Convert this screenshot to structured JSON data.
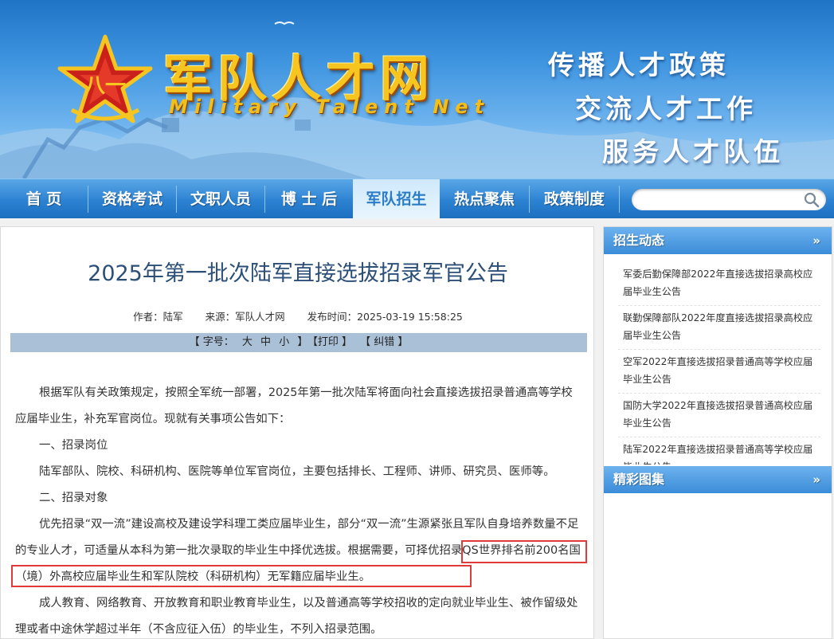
{
  "banner": {
    "title": "军队人才网",
    "title_en": "Military Talent Net",
    "slogans": [
      "传播人才政策",
      "交流人才工作",
      "服务人才队伍"
    ]
  },
  "nav": {
    "items": [
      "首 页",
      "资格考试",
      "文职人员",
      "博 士 后",
      "军队招生",
      "热点聚焦",
      "政策制度"
    ],
    "active": "军队招生",
    "search_placeholder": ""
  },
  "article": {
    "title": "2025年第一批次陆军直接选拔招录军官公告",
    "meta": {
      "author": "作者：陆军",
      "source": "来源：军队人才网",
      "published": "发布时间：2025-03-19 15:58:25"
    },
    "toolbar": {
      "font_label": "【 字号：",
      "size_large": "大",
      "size_medium": "中",
      "size_small": "小",
      "close1": "】",
      "print": "【打印 】",
      "correction": "【 纠错 】"
    },
    "paragraphs": {
      "intro": "根据军队有关政策规定，按照全军统一部署，2025年第一批次陆军将面向社会直接选拔招录普通高等学校应届毕业生，补充军官岗位。现就有关事项公告如下：",
      "h1": "一、招录岗位",
      "p1": "陆军部队、院校、科研机构、医院等单位军官岗位，主要包括排长、工程师、讲师、研究员、医师等。",
      "h2": "二、招录对象",
      "p2": "优先招录“双一流”建设高校及建设学科理工类应届毕业生，部分“双一流”生源紧张且军队自身培养数量不足的专业人才，可适量从本科为第一批次录取的毕业生中择优选拔。根据需要，可择优招录QS世界排名前200名国（境）外高校应届毕业生和军队院校（科研机构）无军籍应届毕业生。",
      "p3": "成人教育、网络教育、开放教育和职业教育毕业生，以及普通高等学校招收的定向就业毕业生、被作留级处理或者中途休学超过半年（不含应征入伍）的毕业生，不列入招录范围。"
    }
  },
  "sidebar": {
    "section1": {
      "title": "招生动态",
      "more": "»",
      "items": [
        "军委后勤保障部2022年直接选拔招录高校应届毕业生公告",
        "联勤保障部队2022年度直接选拔招录高校应届毕业生公告",
        "空军2022年直接选拔招录普通高等学校应届毕业生公告",
        "国防大学2022年直接选拔招录普通高校应届毕业生公告",
        "陆军2022年直接选拔招录普通高等学校应届毕业生公告"
      ]
    },
    "section2": {
      "title": "精彩图集",
      "more": "»"
    }
  },
  "colors": {
    "nav_blue": "#2c82d2",
    "title_gold": "#f6c51f",
    "highlight_red": "#e03a3a",
    "article_title": "#2c4f78"
  }
}
